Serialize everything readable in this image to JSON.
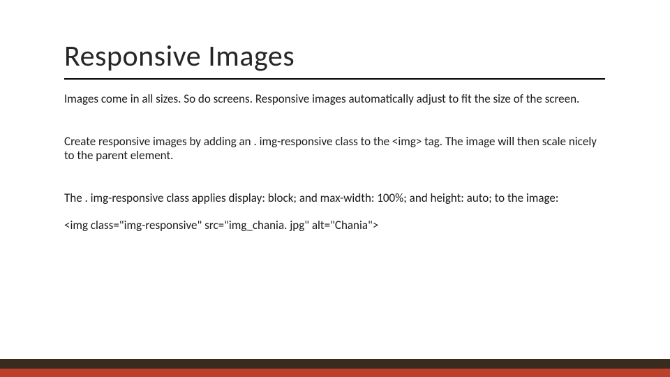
{
  "slide": {
    "title": "Responsive Images",
    "paragraphs": [
      "Images come in all sizes. So do screens. Responsive images automatically adjust to fit the size of the screen.",
      "Create responsive images by adding an . img-responsive class to the <img> tag. The image will then scale nicely to the parent element.",
      "The . img-responsive class applies display: block; and max-width: 100%; and height: auto; to the image:",
      "<img class=\"img-responsive\" src=\"img_chania. jpg\" alt=\"Chania\">"
    ]
  }
}
